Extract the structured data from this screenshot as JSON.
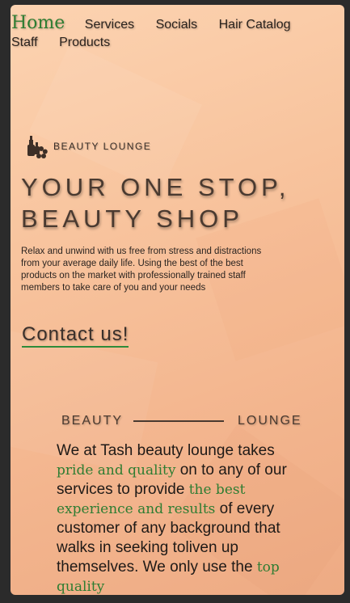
{
  "nav": {
    "home": "Home",
    "services": "Services",
    "socials": "Socials",
    "hair_catalog": "Hair Catalog",
    "staff": "Staff",
    "products": "Products"
  },
  "hero": {
    "brand_name": "BEAUTY LOUNGE",
    "headline_line1": "YOUR ONE STOP,",
    "headline_line2": "BEAUTY SHOP",
    "intro": "Relax and unwind with us free from stress and distractions from your average daily life. Using the best of the best products on the market with professionally trained staff members to take care of you and your needs",
    "contact_label": "Contact us!"
  },
  "divider": {
    "left": "BEAUTY",
    "right": "LOUNGE"
  },
  "about": {
    "t1": "We at Tash beauty lounge takes ",
    "h1": "pride and quality",
    "t2": " on to any of our services to provide ",
    "h2": "the best experience and results",
    "t3": " of every customer of any background that walks in seeking toliven up themselves. We only use the ",
    "h3": "top quality"
  },
  "colors": {
    "accent_green": "#2e7d32",
    "background_peach": "#f8c49e",
    "text_brown": "#4a3a30"
  },
  "icons": {
    "logo": "beauty-products-flower-icon"
  }
}
